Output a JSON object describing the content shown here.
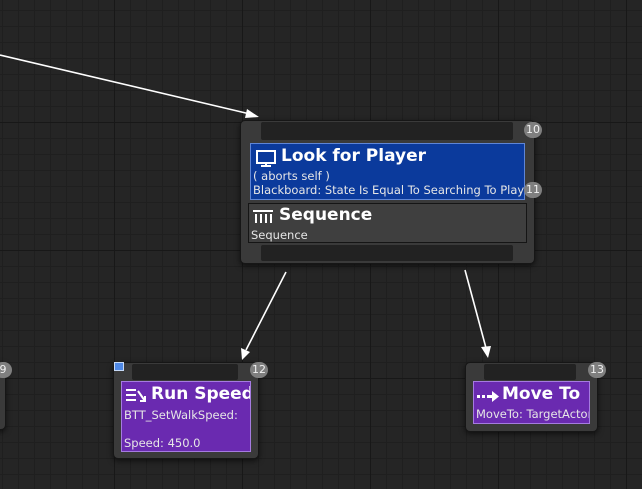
{
  "look_for_player": {
    "index": "10",
    "title": "Look for Player",
    "aborts": "( aborts self )",
    "condition": "Blackboard: State Is Equal To Searching To Player",
    "decorator_index": "11",
    "color": "#0b3a9c"
  },
  "sequence": {
    "title": "Sequence",
    "subtitle": "Sequence"
  },
  "run_speed": {
    "index": "12",
    "title": "Run Speed",
    "line1": "BTT_SetWalkSpeed:",
    "line2": "Speed: 450.0",
    "color": "#6a2ab0"
  },
  "move_to": {
    "index": "13",
    "title": "Move To",
    "line1": "MoveTo: TargetActor",
    "color": "#6a2ab0"
  },
  "offscreen_node": {
    "index": "9"
  }
}
